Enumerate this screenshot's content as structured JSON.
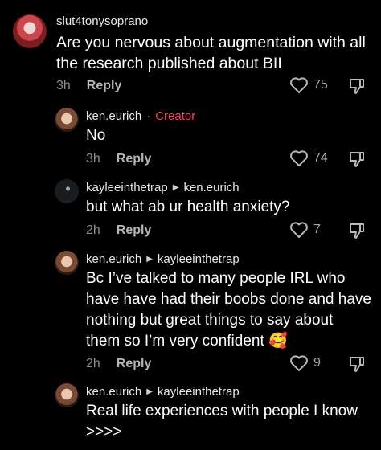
{
  "comments": [
    {
      "username": "slut4tonysoprano",
      "text_lines": [
        "Are you nervous about augmentation with all",
        "the research published about BII"
      ],
      "time": "3h",
      "reply_label": "Reply",
      "likes": "75"
    },
    {
      "username": "ken.eurich",
      "creator_sep": "·",
      "creator_label": "Creator",
      "text_lines": [
        "No"
      ],
      "time": "3h",
      "reply_label": "Reply",
      "likes": "74"
    },
    {
      "username": "kayleeinthetrap",
      "reply_to": "ken.eurich",
      "text_lines": [
        "but what ab ur health anxiety?"
      ],
      "time": "2h",
      "reply_label": "Reply",
      "likes": "7"
    },
    {
      "username": "ken.eurich",
      "reply_to": "kayleeinthetrap",
      "text_lines": [
        "Bc I’ve talked to many people IRL who",
        "have have had their boobs done and have",
        "nothing but great things to say about",
        "them so I’m very confident 🥰"
      ],
      "time": "2h",
      "reply_label": "Reply",
      "likes": "9"
    },
    {
      "username": "ken.eurich",
      "reply_to": "kayleeinthetrap",
      "text_lines": [
        "Real life experiences with people I know",
        ">>>>"
      ]
    }
  ],
  "icons": {
    "avatar": "profile-photo",
    "heart": "heart-outline-icon",
    "dislike": "thumbs-down-outline-icon",
    "reply_arrow": "triangle-right-icon"
  },
  "colors": {
    "background": "#000000",
    "creator": "#ff3b5c",
    "meta": "#8f8f8f"
  }
}
